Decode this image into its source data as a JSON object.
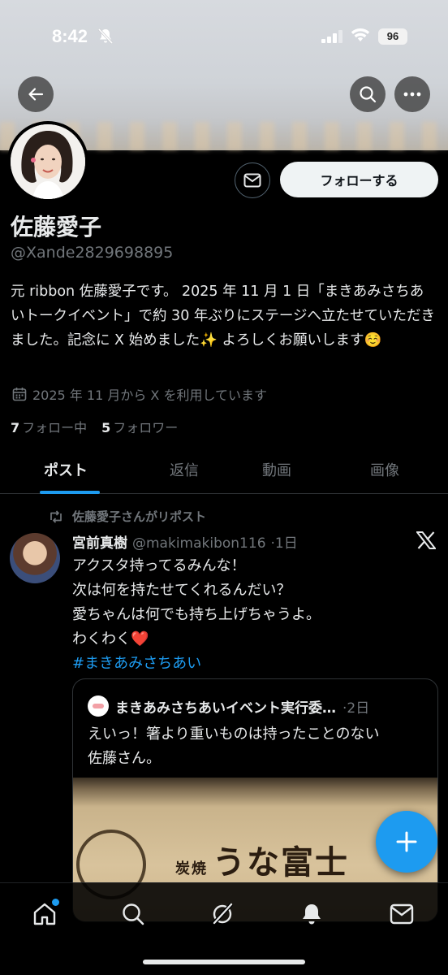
{
  "status_bar": {
    "time": "8:42",
    "battery": "96"
  },
  "profile": {
    "name": "佐藤愛子",
    "handle": "@Xande2829698895",
    "bio": "元 ribbon 佐藤愛子です。 2025 年 11 月 1 日「まきあみさちあいトークイベント」で約 30 年ぶりにステージへ立たせていただきました。記念に X 始めました✨ よろしくお願いします☺️",
    "joined": "2025 年 11 月から X を利用しています",
    "following_count": "7",
    "following_label": "フォロー中",
    "followers_count": "5",
    "followers_label": "フォロワー",
    "follow_button": "フォローする"
  },
  "tabs": [
    {
      "label": "ポスト",
      "active": true
    },
    {
      "label": "返信",
      "active": false
    },
    {
      "label": "動画",
      "active": false
    },
    {
      "label": "画像",
      "active": false
    }
  ],
  "post": {
    "repost_label": "佐藤愛子さんがリポスト",
    "author_name": "宮前真樹",
    "author_handle": "@makimakibon116",
    "time": "·1日",
    "lines": [
      "アクスタ持ってるみんな！",
      "次は何を持たせてくれるんだい？",
      "愛ちゃんは何でも持ち上げちゃうよ。",
      "わくわく❤️"
    ],
    "hashtag": "#まきあみさちあい",
    "quote": {
      "author_name": "まきあみさちあいイベント実行委…",
      "time": "·2日",
      "lines": [
        "えいっ！箸より重いものは持ったことのない",
        "佐藤さん。"
      ],
      "image_text_small": "炭焼",
      "image_text": "うな富士"
    }
  },
  "icons": {
    "back": "arrow-left-icon",
    "search": "search-icon",
    "more": "more-icon",
    "dm": "mail-icon",
    "calendar": "calendar-icon",
    "repost": "repost-icon",
    "x": "x-logo-icon",
    "fab": "plus-icon",
    "nav": [
      "home-icon",
      "search-icon",
      "grok-icon",
      "bell-icon",
      "mail-icon"
    ]
  },
  "colors": {
    "accent": "#1d9bf0",
    "background": "#000000",
    "secondary_text": "#71767b"
  }
}
